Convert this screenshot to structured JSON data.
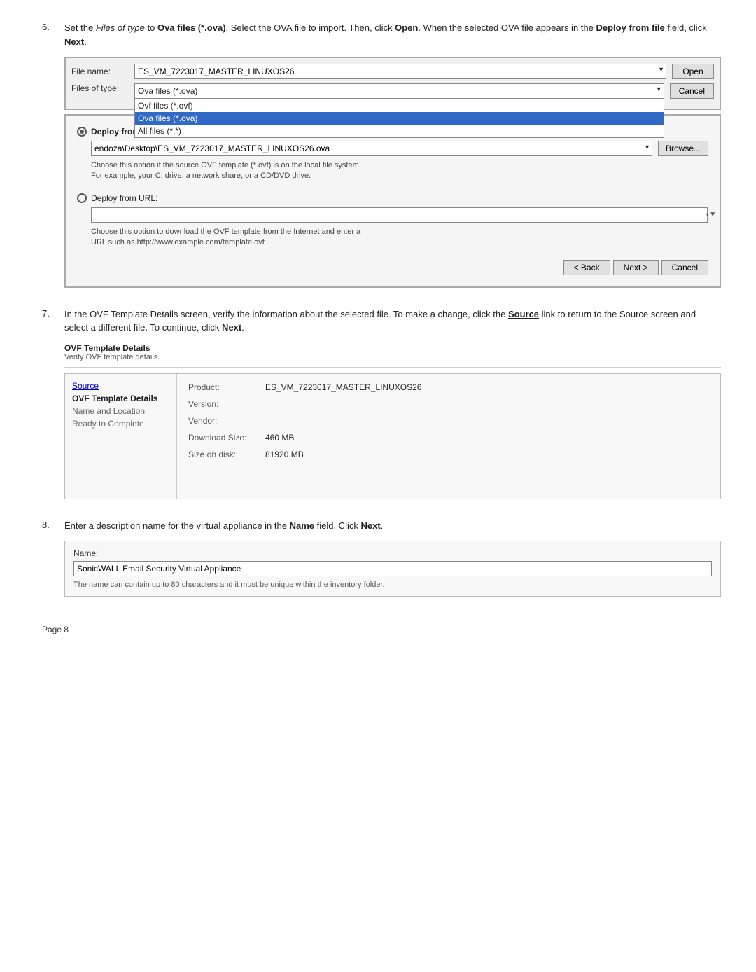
{
  "steps": [
    {
      "number": "6.",
      "text_parts": [
        {
          "type": "text",
          "content": "Set the "
        },
        {
          "type": "em",
          "content": "Files of type"
        },
        {
          "type": "text",
          "content": " to "
        },
        {
          "type": "strong",
          "content": "Ova files (*.ova)"
        },
        {
          "type": "text",
          "content": ". Select the OVA file to import. Then, click "
        },
        {
          "type": "strong",
          "content": "Open"
        },
        {
          "type": "text",
          "content": ". When the selected OVA file appears in the "
        },
        {
          "type": "strong",
          "content": "Deploy from file"
        },
        {
          "type": "text",
          "content": " field, click "
        },
        {
          "type": "strong",
          "content": "Next"
        },
        {
          "type": "text",
          "content": "."
        }
      ],
      "file_dialog": {
        "file_name_label": "File name:",
        "file_name_value": "ES_VM_7223017_MASTER_LINUXOS26",
        "files_of_type_label": "Files of type:",
        "files_of_type_value": "Ova files (*.ova)",
        "open_btn": "Open",
        "cancel_btn": "Cancel",
        "dropdown_items": [
          {
            "label": "Ovf files (*.ovf)",
            "selected": false
          },
          {
            "label": "Ova files (*.ova)",
            "selected": true
          },
          {
            "label": "All files (*.*)",
            "selected": false
          }
        ]
      },
      "deploy_dialog": {
        "deploy_from_file_label": "Deploy from file:",
        "deploy_from_file_radio": true,
        "file_path": "endoza\\Desktop\\ES_VM_7223017_MASTER_LINUXOS26.ova",
        "browse_btn": "Browse...",
        "hint_file": "Choose this option if the source OVF template (*.ovf) is on the local file system.\nFor example, your C: drive, a network share, or a CD/DVD drive.",
        "deploy_from_url_label": "Deploy from URL:",
        "deploy_from_url_radio": false,
        "url_value": "",
        "hint_url": "Choose this option to download the OVF template from the Internet and enter a\nURL such as http://www.example.com/template.ovf",
        "back_btn": "< Back",
        "next_btn": "Next >",
        "cancel_btn": "Cancel"
      }
    },
    {
      "number": "7.",
      "text_parts": [
        {
          "type": "text",
          "content": "In the OVF Template Details screen, verify the information about the selected file. To make a change, click the "
        },
        {
          "type": "strong_link",
          "content": "Source"
        },
        {
          "type": "text",
          "content": " link to return to the Source screen and select a different file. To continue, click "
        },
        {
          "type": "strong",
          "content": "Next"
        },
        {
          "type": "text",
          "content": "."
        }
      ],
      "ovf_header_title": "OVF Template Details",
      "ovf_header_sub": "Verify OVF template details.",
      "ovf_dialog": {
        "sidebar_items": [
          {
            "label": "Source",
            "style": "link"
          },
          {
            "label": "OVF Template Details",
            "style": "bold"
          },
          {
            "label": "Name and Location",
            "style": "muted"
          },
          {
            "label": "Ready to Complete",
            "style": "muted"
          }
        ],
        "details": [
          {
            "key": "Product:",
            "value": "ES_VM_7223017_MASTER_LINUXOS26"
          },
          {
            "key": "Version:",
            "value": ""
          },
          {
            "key": "Vendor:",
            "value": ""
          },
          {
            "key": "Download Size:",
            "value": "460 MB"
          },
          {
            "key": "Size on disk:",
            "value": "81920 MB"
          }
        ]
      }
    },
    {
      "number": "8.",
      "text_parts": [
        {
          "type": "text",
          "content": "Enter a description name for the virtual appliance in the "
        },
        {
          "type": "strong",
          "content": "Name"
        },
        {
          "type": "text",
          "content": " field. Click "
        },
        {
          "type": "strong",
          "content": "Next"
        },
        {
          "type": "text",
          "content": "."
        }
      ],
      "name_dialog": {
        "label": "Name:",
        "value": "SonicWALL Email Security Virtual Appliance",
        "hint": "The name can contain up to 80 characters and it must be unique within the inventory folder."
      }
    }
  ],
  "page_number": "Page 8"
}
